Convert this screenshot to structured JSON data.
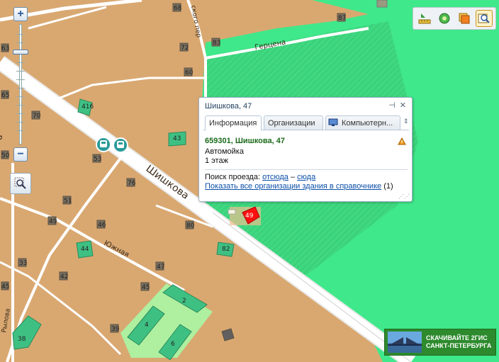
{
  "map": {
    "streets": {
      "shishkova": "Шишкова",
      "yuzhnaya": "Южная",
      "gertsena": "Герцена",
      "lane": "ского пер",
      "rylova": "Рылова",
      "left_edge": "а"
    },
    "buildings": [
      "68",
      "87",
      "83",
      "72",
      "63",
      "60",
      "416",
      "70",
      "43",
      "53",
      "76",
      "51",
      "49",
      "46",
      "80",
      "82",
      "44",
      "33",
      "42",
      "47",
      "45",
      "45",
      "2",
      "4",
      "6",
      "39",
      "38",
      "49",
      "65",
      "50"
    ],
    "colors": {
      "land": "#d9a871",
      "green": "#3fe88a",
      "road": "#ffffff",
      "building": "#3fc083",
      "selected": "#ff1010"
    }
  },
  "zoom": {
    "plus": "+",
    "minus": "−",
    "level_fraction": 0.24
  },
  "toolbar": {
    "icons": [
      "ruler-icon",
      "globe-icon",
      "layers-icon",
      "search-area-icon"
    ]
  },
  "popup": {
    "title": "Шишкова, 47",
    "tabs": [
      "Информация",
      "Организации",
      "Компьютерн..."
    ],
    "address": "659301, Шишкова, 47",
    "type": "Автомойка",
    "floors": "1 этаж",
    "route_label": "Поиск проезда:",
    "route_from": "отсюда",
    "route_dash": "–",
    "route_to": "сюда",
    "show_orgs": "Показать все организации здания в справочнике",
    "show_orgs_count": "(1)"
  },
  "banner": {
    "line1": "СКАЧИВАЙТЕ 2ГИС",
    "line2": "САНКТ-ПЕТЕРБУРГА"
  }
}
